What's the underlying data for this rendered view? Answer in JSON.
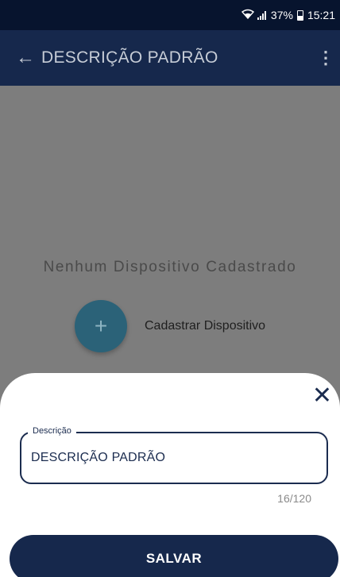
{
  "status_bar": {
    "wifi_icon": "wifi-icon",
    "signal_icon": "signal-icon",
    "battery_percent": "37%",
    "battery_icon": "battery-icon",
    "time": "15:21"
  },
  "app_bar": {
    "back_icon": "←",
    "title": "DESCRIÇÃO PADRÃO",
    "menu_icon": "⋮"
  },
  "empty_state": {
    "message": "Nenhum Dispositivo Cadastrado",
    "fab_icon": "+",
    "fab_label": "Cadastrar Dispositivo"
  },
  "sheet": {
    "close_icon": "✕",
    "field_label": "Descrição",
    "field_value": "DESCRIÇÃO PADRÃO",
    "counter": "16/120",
    "save_label": "SALVAR"
  },
  "colors": {
    "primary": "#16284c",
    "fab": "#2b6278",
    "overlay": "#7d7d7d"
  }
}
